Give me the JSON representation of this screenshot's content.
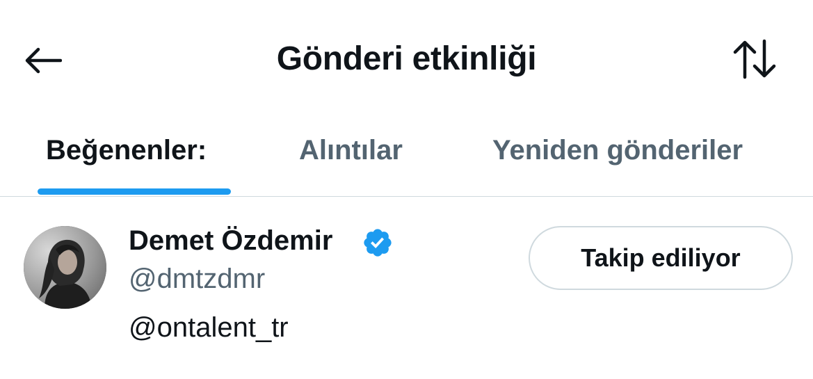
{
  "header": {
    "title": "Gönderi etkinliği",
    "back_icon": "arrow-left-icon",
    "sort_icon": "sort-arrows-icon"
  },
  "tabs": [
    {
      "label": "Beğenenler:",
      "active": true
    },
    {
      "label": "Alıntılar",
      "active": false
    },
    {
      "label": "Yeniden gönderiler",
      "active": false
    }
  ],
  "users": [
    {
      "display_name": "Demet Özdemir",
      "verified": true,
      "handle": "@dmtzdmr",
      "bio": "@ontalent_tr",
      "follow_label": "Takip ediliyor"
    }
  ],
  "colors": {
    "accent": "#1d9bf0",
    "text_primary": "#0f1419",
    "text_secondary": "#536471",
    "border": "#cfd9de"
  }
}
